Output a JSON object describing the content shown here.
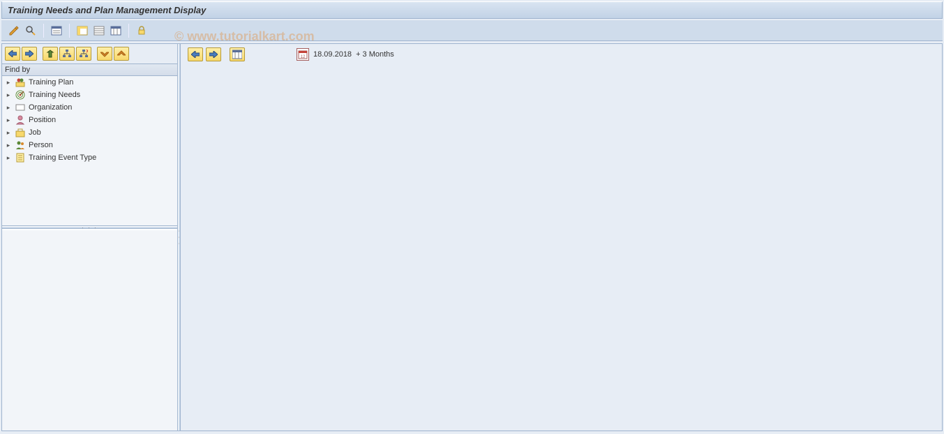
{
  "title": "Training Needs and Plan Management Display",
  "watermark": "© www.tutorialkart.com",
  "sidebar": {
    "findby_label": "Find by",
    "items": [
      {
        "label": "Training Plan",
        "icon": "training-plan-icon"
      },
      {
        "label": "Training Needs",
        "icon": "training-needs-icon"
      },
      {
        "label": "Organization",
        "icon": "organization-icon"
      },
      {
        "label": "Position",
        "icon": "position-icon"
      },
      {
        "label": "Job",
        "icon": "job-icon"
      },
      {
        "label": "Person",
        "icon": "person-icon"
      },
      {
        "label": "Training Event Type",
        "icon": "event-type-icon"
      }
    ]
  },
  "main": {
    "date_from": "18.09.2018",
    "date_period": "+ 3 Months"
  }
}
